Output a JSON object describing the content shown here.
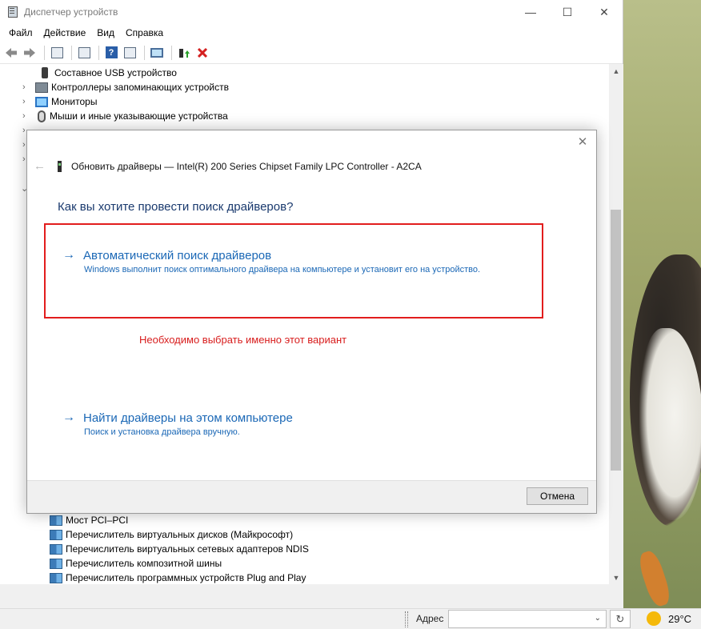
{
  "window": {
    "title": "Диспетчер устройств",
    "controls": {
      "minimize": "—",
      "maximize": "☐",
      "close": "✕"
    }
  },
  "menu": [
    "Файл",
    "Действие",
    "Вид",
    "Справка"
  ],
  "toolbar_icons": [
    "back-arrow-icon",
    "forward-arrow-icon",
    "properties-icon",
    "list-icon",
    "help-icon",
    "view-icon",
    "monitor-icon",
    "update-driver-icon",
    "remove-icon"
  ],
  "tree_top": [
    {
      "label": "Составное USB устройство",
      "icon": "usb-icon",
      "expandable": false,
      "indent": 2
    },
    {
      "label": "Контроллеры запоминающих устройств",
      "icon": "storage-icon",
      "expandable": true,
      "indent": 1
    },
    {
      "label": "Мониторы",
      "icon": "monitor-icon",
      "expandable": true,
      "indent": 1
    },
    {
      "label": "Мыши и иные указывающие устройства",
      "icon": "mouse-icon",
      "expandable": true,
      "indent": 1
    }
  ],
  "tree_bottom": [
    "Мост PCI–PCI",
    "Перечислитель виртуальных дисков (Майкрософт)",
    "Перечислитель виртуальных сетевых адаптеров NDIS",
    "Перечислитель композитной шины",
    "Перечислитель программных устройств Plug and Play"
  ],
  "dialog": {
    "header": "Обновить драйверы — Intel(R) 200 Series Chipset Family LPC Controller - A2CA",
    "question": "Как вы хотите провести поиск драйверов?",
    "option_auto": {
      "title": "Автоматический поиск драйверов",
      "description": "Windows выполнит поиск оптимального драйвера на компьютере и установит его на устройство."
    },
    "annotation": "Необходимо выбрать именно этот вариант",
    "option_manual": {
      "title": "Найти драйверы на этом компьютере",
      "description": "Поиск и установка драйвера вручную."
    },
    "cancel_label": "Отмена",
    "accent_color": "#1b68b6",
    "highlight_color": "#e21d1d"
  },
  "taskbar": {
    "address_label": "Адрес",
    "temperature": "29°C"
  }
}
